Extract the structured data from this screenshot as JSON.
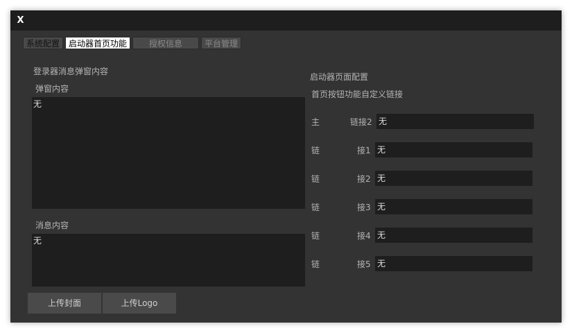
{
  "window": {
    "close_label": "X"
  },
  "tabs": [
    {
      "label": "系统配置"
    },
    {
      "label": "启动器首页功能"
    },
    {
      "label": "授权信息"
    },
    {
      "label": "平台管理"
    }
  ],
  "left": {
    "section_title": "登录器消息弹窗内容",
    "popup_label": "弹窗内容",
    "popup_value": "无",
    "message_label": "消息内容",
    "message_value": "无"
  },
  "right": {
    "section_title": "启动器页面配置",
    "subtitle": "首页按钮功能自定义链接",
    "rows": [
      {
        "prefix": "主",
        "label": "链接2",
        "value": "无"
      },
      {
        "prefix": "链",
        "label": "接1",
        "value": "无"
      },
      {
        "prefix": "链",
        "label": "接2",
        "value": "无"
      },
      {
        "prefix": "链",
        "label": "接3",
        "value": "无"
      },
      {
        "prefix": "链",
        "label": "接4",
        "value": "无"
      },
      {
        "prefix": "链",
        "label": "接5",
        "value": "无"
      }
    ]
  },
  "buttons": {
    "upload_cover": "上传封面",
    "upload_logo": "上传Logo"
  }
}
